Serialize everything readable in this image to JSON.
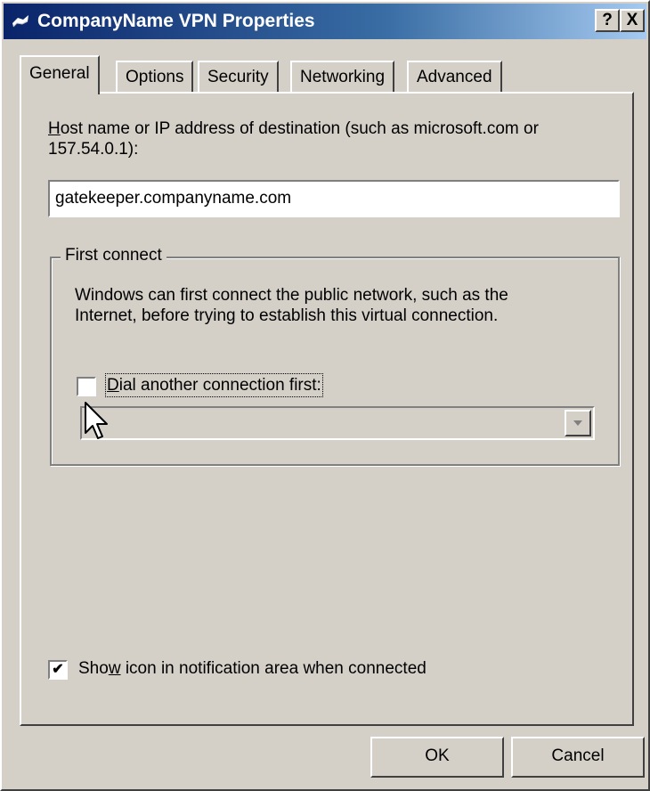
{
  "window": {
    "title": "CompanyName VPN Properties",
    "help_label": "?",
    "close_label": "X"
  },
  "tabs": [
    {
      "label": "General",
      "active": true
    },
    {
      "label": "Options",
      "active": false
    },
    {
      "label": "Security",
      "active": false
    },
    {
      "label": "Networking",
      "active": false
    },
    {
      "label": "Advanced",
      "active": false
    }
  ],
  "general": {
    "host_label_line1_prefix": "H",
    "host_label_line1_rest": "ost name or IP address of destination (such as microsoft.com or",
    "host_label_line2": "157.54.0.1):",
    "host_value": "gatekeeper.companyname.com",
    "first_connect": {
      "legend": "First connect",
      "description_line1": "Windows can first connect the public network, such as the",
      "description_line2": "Internet, before trying to establish this virtual connection.",
      "dial_first_prefix": "D",
      "dial_first_rest": "ial another connection first:",
      "dial_first_checked": false,
      "connection_selected": ""
    },
    "show_icon_prefix": "Sho",
    "show_icon_mnemonic": "w",
    "show_icon_rest": " icon in notification area when connected",
    "show_icon_checked": true
  },
  "buttons": {
    "ok": "OK",
    "cancel": "Cancel"
  },
  "icons": {
    "title": "network-connection-icon",
    "cursor": "mouse-pointer-icon",
    "dropdown": "chevron-down-icon",
    "check": "checkmark-icon"
  }
}
